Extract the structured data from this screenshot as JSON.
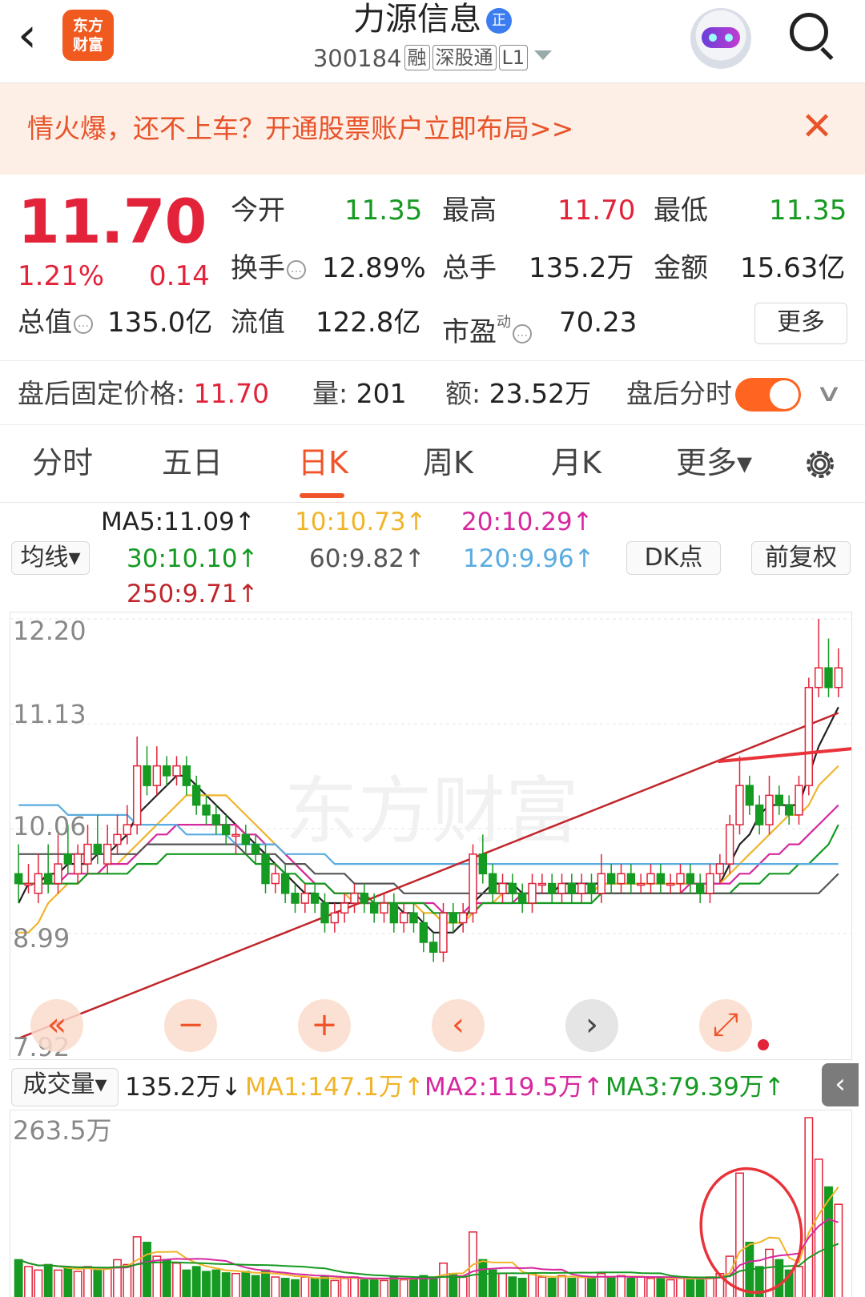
{
  "header": {
    "back_icon": "chevron-left-icon",
    "logo_text_1": "东方",
    "logo_text_2": "财富",
    "stock_name": "力源信息",
    "name_badge": "正",
    "code": "300184",
    "tags": [
      "融",
      "深股通",
      "L1"
    ]
  },
  "banner": {
    "text": "情火爆，还不上车？开通股票账户立即布局>>",
    "close": "✕"
  },
  "quote": {
    "price": "11.70",
    "change_pct": "1.21%",
    "change": "0.14",
    "open_label": "今开",
    "open": "11.35",
    "high_label": "最高",
    "high": "11.70",
    "low_label": "最低",
    "low": "11.35",
    "turnover_label": "换手",
    "turnover": "12.89%",
    "volume_label": "总手",
    "volume": "135.2万",
    "amount_label": "金额",
    "amount": "15.63亿",
    "mcap_label": "总值",
    "mcap": "135.0亿",
    "float_label": "流值",
    "float": "122.8亿",
    "pe_label": "市盈",
    "pe_sup": "动",
    "pe": "70.23",
    "more": "更多"
  },
  "after_hours": {
    "price_label": "盘后固定价格:",
    "price": "11.70",
    "vol_label": "量:",
    "vol": "201",
    "amt_label": "额:",
    "amt": "23.52万",
    "toggle_label": "盘后分时",
    "toggle_on": true
  },
  "tabs": [
    {
      "label": "分时"
    },
    {
      "label": "五日"
    },
    {
      "label": "日K",
      "active": true
    },
    {
      "label": "周K"
    },
    {
      "label": "月K"
    },
    {
      "label": "更多▾"
    }
  ],
  "ma": {
    "selector": "均线▾",
    "ma5": "MA5:11.09↑",
    "ma10": "10:10.73↑",
    "ma20": "20:10.29↑",
    "ma30": "30:10.10↑",
    "ma60": "60:9.82↑",
    "ma120": "120:9.96↑",
    "ma250": "250:9.71↑",
    "dk_button": "DK点",
    "adjust_button": "前复权",
    "colors": {
      "ma5": "#222222",
      "ma10": "#f0b429",
      "ma20": "#d6289e",
      "ma30": "#159a22",
      "ma60": "#555555",
      "ma120": "#5aace0",
      "ma250": "#c0262b"
    }
  },
  "price_axis": [
    "12.20",
    "11.13",
    "10.06",
    "8.99",
    "7.92"
  ],
  "watermark": "东方财富",
  "nav_buttons": [
    {
      "name": "fast-back",
      "glyph": "«",
      "style": "o"
    },
    {
      "name": "zoom-out",
      "glyph": "−",
      "style": "o"
    },
    {
      "name": "zoom-in",
      "glyph": "+",
      "style": "o"
    },
    {
      "name": "prev",
      "glyph": "‹",
      "style": "o"
    },
    {
      "name": "next",
      "glyph": "›",
      "style": "g"
    },
    {
      "name": "fullscreen",
      "glyph": "⤢",
      "style": "o"
    }
  ],
  "volume": {
    "selector": "成交量▾",
    "vol": "135.2万↓",
    "ma1": "MA1:147.1万↑",
    "ma2": "MA2:119.5万↑",
    "ma3": "MA3:79.39万↑",
    "axis_top": "263.5万"
  },
  "chart_data": {
    "type": "candlestick",
    "ylim": [
      7.92,
      12.2
    ],
    "candles": [
      [
        9.6,
        9.5,
        9.9,
        9.3
      ],
      [
        9.5,
        9.5,
        9.7,
        9.4
      ],
      [
        9.4,
        9.6,
        9.8,
        9.3
      ],
      [
        9.6,
        9.5,
        9.9,
        9.4
      ],
      [
        9.5,
        9.7,
        10.0,
        9.4
      ],
      [
        9.8,
        9.7,
        10.1,
        9.6
      ],
      [
        9.6,
        9.8,
        9.9,
        9.5
      ],
      [
        9.7,
        9.9,
        10.1,
        9.6
      ],
      [
        9.9,
        9.8,
        10.2,
        9.7
      ],
      [
        9.7,
        9.9,
        10.1,
        9.6
      ],
      [
        9.9,
        10.0,
        10.2,
        9.8
      ],
      [
        10.0,
        10.1,
        10.3,
        9.9
      ],
      [
        10.1,
        10.7,
        11.0,
        10.0
      ],
      [
        10.7,
        10.5,
        10.9,
        10.4
      ],
      [
        10.5,
        10.7,
        10.9,
        10.4
      ],
      [
        10.7,
        10.6,
        10.8,
        10.5
      ],
      [
        10.6,
        10.7,
        10.8,
        10.5
      ],
      [
        10.7,
        10.5,
        10.8,
        10.4
      ],
      [
        10.5,
        10.3,
        10.6,
        10.2
      ],
      [
        10.3,
        10.2,
        10.4,
        10.1
      ],
      [
        10.2,
        10.1,
        10.3,
        10.0
      ],
      [
        10.1,
        10.0,
        10.2,
        9.9
      ],
      [
        10.0,
        10.0,
        10.1,
        9.8
      ],
      [
        10.0,
        9.9,
        10.1,
        9.8
      ],
      [
        9.9,
        9.8,
        10.0,
        9.7
      ],
      [
        9.8,
        9.5,
        9.9,
        9.4
      ],
      [
        9.5,
        9.6,
        9.7,
        9.4
      ],
      [
        9.6,
        9.4,
        9.7,
        9.3
      ],
      [
        9.4,
        9.3,
        9.5,
        9.2
      ],
      [
        9.3,
        9.4,
        9.5,
        9.2
      ],
      [
        9.4,
        9.3,
        9.5,
        9.2
      ],
      [
        9.3,
        9.1,
        9.4,
        9.0
      ],
      [
        9.1,
        9.2,
        9.3,
        9.0
      ],
      [
        9.2,
        9.3,
        9.4,
        9.1
      ],
      [
        9.3,
        9.4,
        9.5,
        9.2
      ],
      [
        9.4,
        9.3,
        9.5,
        9.2
      ],
      [
        9.3,
        9.2,
        9.4,
        9.1
      ],
      [
        9.2,
        9.3,
        9.4,
        9.1
      ],
      [
        9.3,
        9.1,
        9.4,
        9.0
      ],
      [
        9.1,
        9.2,
        9.3,
        9.0
      ],
      [
        9.2,
        9.1,
        9.3,
        9.0
      ],
      [
        9.1,
        8.9,
        9.2,
        8.8
      ],
      [
        8.9,
        8.8,
        9.0,
        8.7
      ],
      [
        8.8,
        9.2,
        9.3,
        8.7
      ],
      [
        9.2,
        9.1,
        9.3,
        9.0
      ],
      [
        9.1,
        9.2,
        9.3,
        9.0
      ],
      [
        9.2,
        9.8,
        9.9,
        9.1
      ],
      [
        9.8,
        9.6,
        10.0,
        9.5
      ],
      [
        9.6,
        9.4,
        9.7,
        9.3
      ],
      [
        9.4,
        9.5,
        9.6,
        9.3
      ],
      [
        9.5,
        9.4,
        9.6,
        9.3
      ],
      [
        9.4,
        9.3,
        9.5,
        9.2
      ],
      [
        9.3,
        9.5,
        9.6,
        9.2
      ],
      [
        9.5,
        9.5,
        9.6,
        9.4
      ],
      [
        9.5,
        9.4,
        9.6,
        9.3
      ],
      [
        9.4,
        9.5,
        9.6,
        9.3
      ],
      [
        9.5,
        9.4,
        9.6,
        9.3
      ],
      [
        9.4,
        9.5,
        9.6,
        9.3
      ],
      [
        9.5,
        9.4,
        9.6,
        9.3
      ],
      [
        9.4,
        9.6,
        9.8,
        9.3
      ],
      [
        9.6,
        9.5,
        9.7,
        9.4
      ],
      [
        9.5,
        9.6,
        9.7,
        9.4
      ],
      [
        9.6,
        9.5,
        9.7,
        9.4
      ],
      [
        9.5,
        9.5,
        9.6,
        9.4
      ],
      [
        9.5,
        9.6,
        9.7,
        9.4
      ],
      [
        9.6,
        9.5,
        9.7,
        9.4
      ],
      [
        9.5,
        9.5,
        9.6,
        9.4
      ],
      [
        9.5,
        9.6,
        9.7,
        9.4
      ],
      [
        9.6,
        9.5,
        9.7,
        9.4
      ],
      [
        9.5,
        9.4,
        9.6,
        9.3
      ],
      [
        9.4,
        9.6,
        9.7,
        9.3
      ],
      [
        9.6,
        9.7,
        9.8,
        9.5
      ],
      [
        9.7,
        10.1,
        10.2,
        9.6
      ],
      [
        10.1,
        10.5,
        10.8,
        10.0
      ],
      [
        10.5,
        10.3,
        10.6,
        10.2
      ],
      [
        10.3,
        10.1,
        10.4,
        10.0
      ],
      [
        10.1,
        10.4,
        10.6,
        10.0
      ],
      [
        10.4,
        10.3,
        10.5,
        10.2
      ],
      [
        10.3,
        10.2,
        10.4,
        10.1
      ],
      [
        10.2,
        10.5,
        10.6,
        10.1
      ],
      [
        10.5,
        11.5,
        11.6,
        10.4
      ],
      [
        11.5,
        11.7,
        12.2,
        11.4
      ],
      [
        11.7,
        11.5,
        12.0,
        11.4
      ],
      [
        11.5,
        11.7,
        11.9,
        11.4
      ]
    ],
    "ma_series": {
      "ma5": [
        9.3,
        9.5,
        9.5,
        9.6,
        9.6,
        9.7,
        9.7,
        9.7,
        9.8,
        9.8,
        9.9,
        10.0,
        10.2,
        10.3,
        10.4,
        10.5,
        10.6,
        10.6,
        10.5,
        10.4,
        10.3,
        10.2,
        10.1,
        10.0,
        9.9,
        9.8,
        9.7,
        9.6,
        9.5,
        9.4,
        9.4,
        9.3,
        9.3,
        9.3,
        9.3,
        9.3,
        9.3,
        9.3,
        9.3,
        9.2,
        9.2,
        9.1,
        9.0,
        9.0,
        9.0,
        9.1,
        9.3,
        9.4,
        9.5,
        9.5,
        9.5,
        9.4,
        9.4,
        9.4,
        9.4,
        9.5,
        9.5,
        9.5,
        9.5,
        9.5,
        9.5,
        9.5,
        9.5,
        9.5,
        9.5,
        9.5,
        9.5,
        9.5,
        9.5,
        9.5,
        9.5,
        9.5,
        9.7,
        9.9,
        10.0,
        10.2,
        10.3,
        10.3,
        10.3,
        10.3,
        10.6,
        10.9,
        11.1,
        11.3
      ],
      "ma10": [
        9.0,
        9.0,
        9.1,
        9.3,
        9.4,
        9.5,
        9.5,
        9.6,
        9.6,
        9.7,
        9.7,
        9.8,
        9.9,
        10.0,
        10.1,
        10.2,
        10.3,
        10.4,
        10.4,
        10.4,
        10.4,
        10.4,
        10.3,
        10.2,
        10.1,
        10.0,
        9.9,
        9.8,
        9.7,
        9.6,
        9.5,
        9.5,
        9.4,
        9.4,
        9.3,
        9.3,
        9.3,
        9.3,
        9.3,
        9.3,
        9.3,
        9.2,
        9.2,
        9.1,
        9.1,
        9.1,
        9.2,
        9.3,
        9.3,
        9.4,
        9.4,
        9.4,
        9.4,
        9.4,
        9.4,
        9.4,
        9.4,
        9.4,
        9.4,
        9.5,
        9.5,
        9.5,
        9.5,
        9.5,
        9.5,
        9.5,
        9.5,
        9.5,
        9.5,
        9.5,
        9.5,
        9.5,
        9.6,
        9.7,
        9.8,
        9.9,
        10.0,
        10.1,
        10.2,
        10.2,
        10.3,
        10.5,
        10.6,
        10.7
      ],
      "ma20": [
        9.5,
        9.5,
        9.5,
        9.5,
        9.5,
        9.6,
        9.6,
        9.6,
        9.6,
        9.7,
        9.7,
        9.7,
        9.8,
        9.9,
        10.0,
        10.0,
        10.1,
        10.1,
        10.1,
        10.1,
        10.1,
        10.1,
        10.1,
        10.0,
        10.0,
        9.9,
        9.9,
        9.8,
        9.7,
        9.6,
        9.5,
        9.5,
        9.4,
        9.4,
        9.4,
        9.3,
        9.3,
        9.3,
        9.3,
        9.3,
        9.3,
        9.3,
        9.3,
        9.2,
        9.2,
        9.2,
        9.3,
        9.3,
        9.3,
        9.3,
        9.3,
        9.4,
        9.4,
        9.4,
        9.4,
        9.4,
        9.4,
        9.4,
        9.4,
        9.4,
        9.4,
        9.4,
        9.4,
        9.4,
        9.4,
        9.4,
        9.4,
        9.4,
        9.5,
        9.5,
        9.5,
        9.5,
        9.5,
        9.6,
        9.6,
        9.7,
        9.8,
        9.8,
        9.9,
        9.9,
        10.0,
        10.1,
        10.2,
        10.3
      ],
      "ma30": [
        9.5,
        9.5,
        9.5,
        9.5,
        9.5,
        9.5,
        9.5,
        9.6,
        9.6,
        9.6,
        9.6,
        9.6,
        9.7,
        9.7,
        9.7,
        9.8,
        9.8,
        9.8,
        9.8,
        9.8,
        9.8,
        9.8,
        9.8,
        9.8,
        9.7,
        9.7,
        9.7,
        9.6,
        9.6,
        9.5,
        9.5,
        9.5,
        9.4,
        9.4,
        9.4,
        9.4,
        9.3,
        9.3,
        9.3,
        9.3,
        9.3,
        9.3,
        9.2,
        9.2,
        9.2,
        9.2,
        9.2,
        9.3,
        9.3,
        9.3,
        9.3,
        9.3,
        9.3,
        9.3,
        9.3,
        9.3,
        9.3,
        9.3,
        9.3,
        9.4,
        9.4,
        9.4,
        9.4,
        9.4,
        9.4,
        9.4,
        9.4,
        9.4,
        9.4,
        9.4,
        9.4,
        9.4,
        9.4,
        9.5,
        9.5,
        9.5,
        9.6,
        9.6,
        9.6,
        9.7,
        9.7,
        9.8,
        9.9,
        10.1
      ],
      "ma60": [
        9.8,
        9.8,
        9.8,
        9.8,
        9.8,
        9.8,
        9.8,
        9.8,
        9.8,
        9.8,
        9.8,
        9.8,
        9.8,
        9.9,
        9.9,
        9.9,
        9.9,
        9.9,
        9.9,
        9.9,
        9.9,
        9.9,
        9.9,
        9.8,
        9.8,
        9.8,
        9.8,
        9.7,
        9.7,
        9.7,
        9.6,
        9.6,
        9.6,
        9.6,
        9.5,
        9.5,
        9.5,
        9.5,
        9.5,
        9.4,
        9.4,
        9.4,
        9.4,
        9.4,
        9.4,
        9.4,
        9.4,
        9.4,
        9.4,
        9.4,
        9.4,
        9.4,
        9.4,
        9.4,
        9.4,
        9.4,
        9.4,
        9.4,
        9.4,
        9.4,
        9.4,
        9.4,
        9.4,
        9.4,
        9.4,
        9.4,
        9.4,
        9.4,
        9.4,
        9.4,
        9.4,
        9.4,
        9.4,
        9.4,
        9.4,
        9.4,
        9.4,
        9.4,
        9.4,
        9.4,
        9.4,
        9.4,
        9.5,
        9.6
      ],
      "ma120": [
        10.3,
        10.3,
        10.3,
        10.3,
        10.3,
        10.2,
        10.2,
        10.2,
        10.2,
        10.2,
        10.2,
        10.2,
        10.1,
        10.1,
        10.1,
        10.1,
        10.1,
        10.0,
        10.0,
        10.0,
        10.0,
        10.0,
        9.9,
        9.9,
        9.9,
        9.9,
        9.9,
        9.8,
        9.8,
        9.8,
        9.8,
        9.8,
        9.7,
        9.7,
        9.7,
        9.7,
        9.7,
        9.7,
        9.7,
        9.7,
        9.7,
        9.7,
        9.7,
        9.7,
        9.7,
        9.7,
        9.7,
        9.7,
        9.7,
        9.7,
        9.7,
        9.7,
        9.7,
        9.7,
        9.7,
        9.7,
        9.7,
        9.7,
        9.7,
        9.7,
        9.7,
        9.7,
        9.7,
        9.7,
        9.7,
        9.7,
        9.7,
        9.7,
        9.7,
        9.7,
        9.7,
        9.7,
        9.7,
        9.7,
        9.7,
        9.7,
        9.7,
        9.7,
        9.7,
        9.7,
        9.7,
        9.7,
        9.7,
        9.7
      ],
      "ma250": [
        7.92,
        7.96,
        8.0,
        8.04,
        8.08,
        8.12,
        8.16,
        8.2,
        8.24,
        8.28,
        8.32,
        8.36,
        8.4,
        8.44,
        8.48,
        8.52,
        8.56,
        8.6,
        8.64,
        8.68,
        8.72,
        8.76,
        8.8,
        8.84,
        8.88,
        8.92,
        8.96,
        9.0,
        9.04,
        9.08,
        9.12,
        9.16,
        9.2,
        9.24,
        9.28,
        9.32,
        9.36,
        9.4,
        9.44,
        9.48,
        9.52,
        9.56,
        9.6,
        9.64,
        9.68,
        9.72,
        9.76,
        9.8,
        9.84,
        9.88,
        9.92,
        9.96,
        10.0,
        10.04,
        10.08,
        10.12,
        10.16,
        10.2,
        10.24,
        10.28,
        10.32,
        10.36,
        10.4,
        10.44,
        10.48,
        10.52,
        10.56,
        10.6,
        10.64,
        10.68,
        10.72,
        10.76,
        10.8,
        10.84,
        10.88,
        10.92,
        10.96,
        11.0,
        11.04,
        11.08,
        11.12,
        11.16,
        11.2,
        11.24
      ]
    },
    "volume_ylim": [
      0,
      263.5
    ],
    "volumes": [
      55,
      45,
      40,
      48,
      40,
      42,
      38,
      45,
      40,
      42,
      55,
      48,
      88,
      80,
      60,
      55,
      50,
      40,
      45,
      38,
      40,
      36,
      35,
      38,
      32,
      40,
      30,
      28,
      26,
      30,
      28,
      32,
      25,
      28,
      30,
      26,
      28,
      25,
      30,
      26,
      28,
      32,
      30,
      50,
      35,
      30,
      95,
      55,
      40,
      35,
      30,
      28,
      35,
      30,
      28,
      32,
      28,
      30,
      28,
      35,
      30,
      32,
      28,
      30,
      28,
      30,
      26,
      28,
      26,
      28,
      30,
      35,
      60,
      180,
      80,
      45,
      70,
      55,
      40,
      45,
      260,
      200,
      160,
      135
    ],
    "volume_colors": [
      "up",
      "down"
    ],
    "annotations": [
      "red trend line",
      "red circle around volume spike"
    ]
  }
}
